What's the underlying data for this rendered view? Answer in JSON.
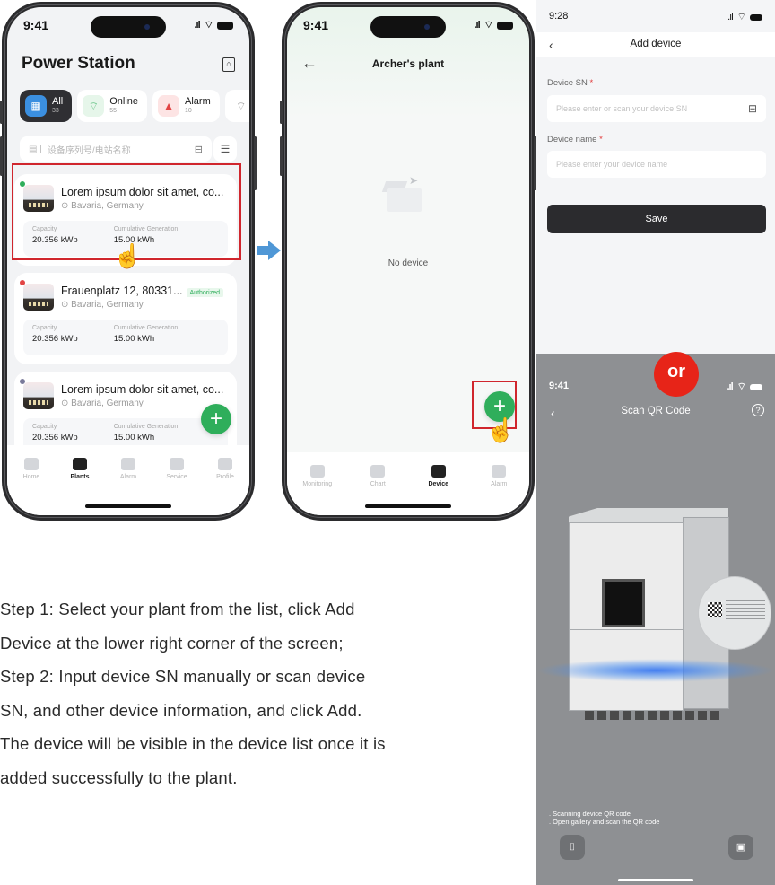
{
  "phone1": {
    "time": "9:41",
    "title": "Power Station",
    "filters": [
      {
        "label": "All",
        "count": "33"
      },
      {
        "label": "Online",
        "count": "55"
      },
      {
        "label": "Alarm",
        "count": "10"
      }
    ],
    "search_placeholder": "设备序列号/电站名称",
    "plants": [
      {
        "name": "Lorem ipsum dolor sit amet, co...",
        "location": "Bavaria, Germany",
        "capacity_label": "Capacity",
        "capacity": "20.356 kWp",
        "generation_label": "Cumulative Generation",
        "generation": "15.00 kWh",
        "status_color": "#2fae5b"
      },
      {
        "name": "Frauenplatz 12, 80331...",
        "badge": "Authorized",
        "location": "Bavaria, Germany",
        "capacity_label": "Capacity",
        "capacity": "20.356 kWp",
        "generation_label": "Cumulative Generation",
        "generation": "15.00 kWh",
        "status_color": "#e24444"
      },
      {
        "name": "Lorem ipsum dolor sit amet, co...",
        "location": "Bavaria, Germany",
        "capacity_label": "Capacity",
        "capacity": "20.356 kWp",
        "generation_label": "Cumulative Generation",
        "generation": "15.00 kWh",
        "status_color": "#7a7a9a"
      }
    ],
    "tabs": [
      "Home",
      "Plants",
      "Alarm",
      "Service",
      "Profile"
    ],
    "active_tab": "Plants"
  },
  "phone2": {
    "time": "9:41",
    "title": "Archer's plant",
    "empty_text": "No device",
    "tabs": [
      "Monitoring",
      "Chart",
      "Device",
      "Alarm"
    ],
    "active_tab": "Device"
  },
  "add_device": {
    "time": "9:28",
    "title": "Add device",
    "sn_label": "Device SN",
    "sn_placeholder": "Please enter or scan your device SN",
    "name_label": "Device name",
    "name_placeholder": "Please enter your device name",
    "required_mark": "*",
    "save_label": "Save"
  },
  "or_label": "or",
  "scan": {
    "time": "9:41",
    "title": "Scan QR Code",
    "hint1": ". Scanning device QR code",
    "hint2": ". Open gallery and scan the QR code"
  },
  "steps": [
    "Step 1: Select your plant from the list, click Add",
    "Device at the lower right corner of the screen;",
    "Step 2: Input device SN manually or scan device",
    "SN, and other device information, and click Add.",
    "The device will be visible in the device list once it is",
    "added successfully to the plant."
  ],
  "colors": {
    "accent_green": "#2fae5b",
    "highlight_red": "#d0262d",
    "or_red": "#e72418",
    "arrow_blue": "#4f97d6",
    "save_dark": "#2b2b2e"
  }
}
